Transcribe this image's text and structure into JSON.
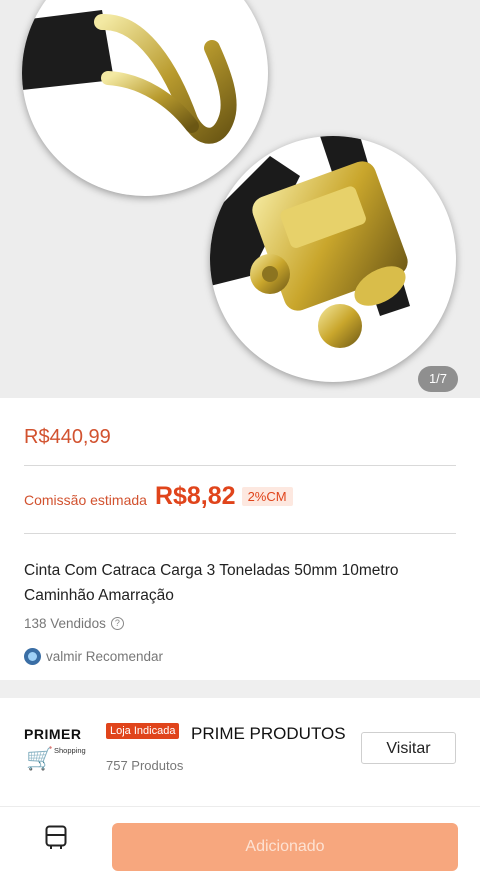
{
  "gallery": {
    "counter": "1/7"
  },
  "product": {
    "price": "R$440,99",
    "commission_label": "Comissão estimada",
    "commission_value": "R$8,82",
    "commission_pct": "2%CM",
    "title": "Cinta Com Catraca Carga 3 Toneladas 50mm 10metro Caminhão Amarração",
    "sold": "138 Vendidos",
    "recommender": "valmir Recomendar"
  },
  "store": {
    "logo_text": "PRIMER",
    "logo_sub": "Shopping",
    "badge": "Loja Indicada",
    "name": "PRIME PRODUTOS",
    "product_count": "757 Produtos",
    "visit_label": "Visitar"
  },
  "bottom": {
    "add_label": "Adicionado"
  },
  "colors": {
    "accent": "#e0441b",
    "button": "#f7a77e"
  },
  "icons": [
    "help-icon",
    "avatar-icon",
    "shopping-cart-icon",
    "store-icon"
  ]
}
